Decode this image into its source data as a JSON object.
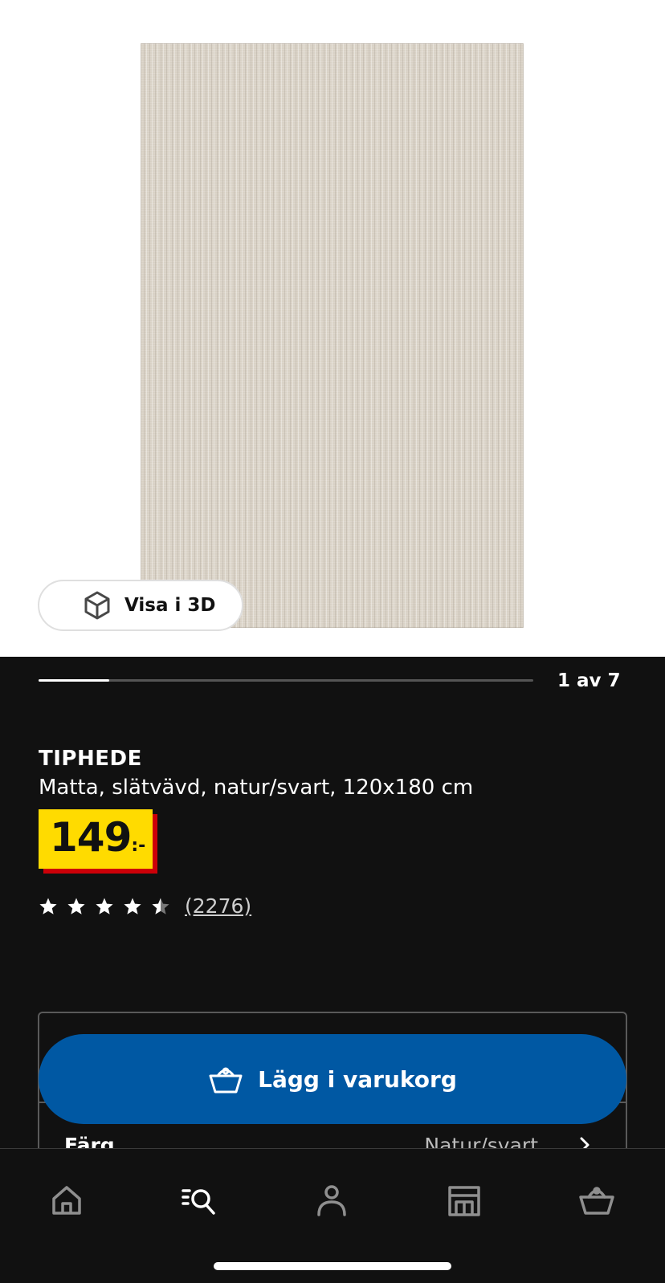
{
  "gallery": {
    "view3d_label": "Visa i 3D",
    "progress_fraction": 0.142857,
    "counter": "1 av 7"
  },
  "product": {
    "name": "TIPHEDE",
    "description": "Matta, slätvävd, natur/svart, 120x180 cm",
    "price_main": "149",
    "price_suffix": ":-",
    "rating_value": 4.5,
    "rating_max": 5,
    "review_count": "(2276)"
  },
  "card": {
    "color_label": "Färg",
    "color_value": "Natur/svart"
  },
  "cta": {
    "add_to_cart_label": "Lägg i varukorg"
  },
  "nav": {
    "items": [
      "home-icon",
      "search-icon",
      "profile-icon",
      "store-icon",
      "cart-icon"
    ]
  },
  "colors": {
    "price_bg": "#ffdb00",
    "price_shadow": "#cc0008",
    "cta_blue": "#0058a3",
    "background": "#111111"
  }
}
